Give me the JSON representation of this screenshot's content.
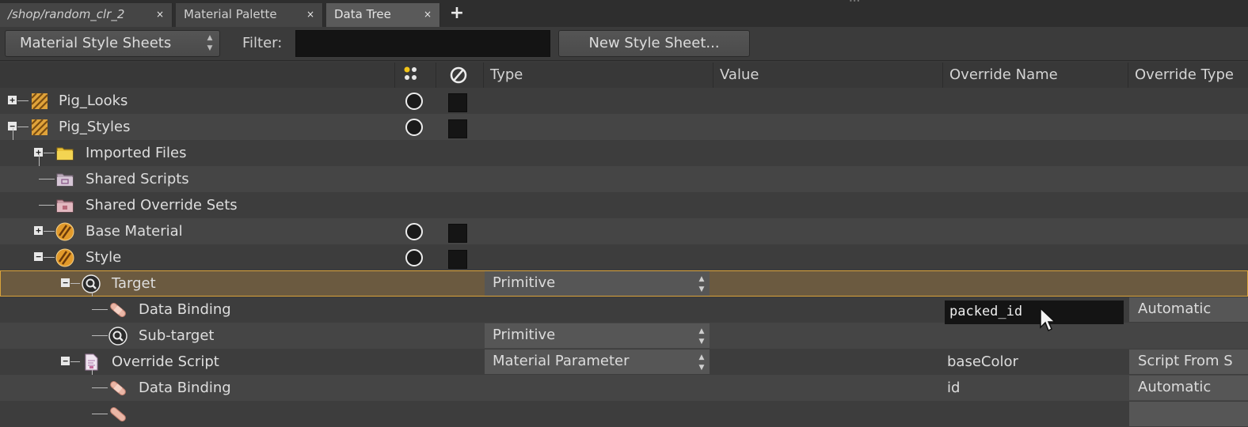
{
  "tabs": [
    {
      "label": "/shop/random_clr_2",
      "close": "×"
    },
    {
      "label": "Material Palette",
      "close": "×"
    },
    {
      "label": "Data Tree",
      "close": "×"
    }
  ],
  "add_tab_label": "+",
  "toolbar": {
    "sheet_select_value": "Material Style Sheets",
    "filter_label": "Filter:",
    "filter_value": "",
    "new_sheet_label": "New Style Sheet..."
  },
  "columns": {
    "type": "Type",
    "value": "Value",
    "override_name": "Override Name",
    "override_type": "Override Type"
  },
  "rows": [
    {
      "name": "Pig_Looks"
    },
    {
      "name": "Pig_Styles"
    },
    {
      "name": "Imported Files"
    },
    {
      "name": "Shared Scripts"
    },
    {
      "name": "Shared Override Sets"
    },
    {
      "name": "Base Material"
    },
    {
      "name": "Style"
    },
    {
      "name": "Target",
      "type": "Primitive"
    },
    {
      "name": "Data Binding",
      "override_name": "packed_id",
      "override_type": "Automatic"
    },
    {
      "name": "Sub-target",
      "type": "Primitive"
    },
    {
      "name": "Override Script",
      "type": "Material Parameter",
      "override_name": "baseColor",
      "override_type": "Script From S"
    },
    {
      "name": "Data Binding",
      "override_name": "id",
      "override_type": "Automatic"
    }
  ],
  "colors": {
    "selection_outline": "#d9a23a",
    "selection_fill": "#6b5a40"
  }
}
